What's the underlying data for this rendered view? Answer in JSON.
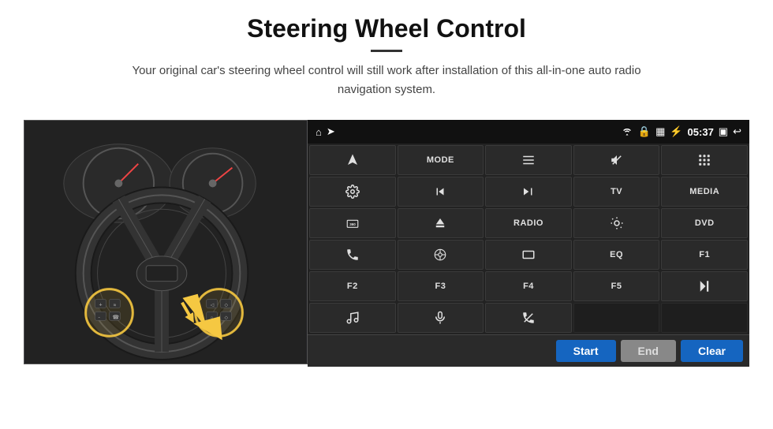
{
  "page": {
    "title": "Steering Wheel Control",
    "subtitle": "Your original car's steering wheel control will still work after installation of this all-in-one auto radio navigation system."
  },
  "status_bar": {
    "time": "05:37",
    "icons": [
      "home",
      "wifi",
      "lock",
      "sim",
      "bluetooth",
      "screen",
      "back"
    ]
  },
  "grid_buttons": [
    {
      "id": "nav",
      "type": "icon",
      "icon": "nav"
    },
    {
      "id": "mode",
      "type": "text",
      "label": "MODE"
    },
    {
      "id": "list",
      "type": "icon",
      "icon": "list"
    },
    {
      "id": "mute",
      "type": "icon",
      "icon": "mute"
    },
    {
      "id": "apps",
      "type": "icon",
      "icon": "apps"
    },
    {
      "id": "settings2",
      "type": "icon",
      "icon": "settings"
    },
    {
      "id": "prev",
      "type": "icon",
      "icon": "prev"
    },
    {
      "id": "next",
      "type": "icon",
      "icon": "next"
    },
    {
      "id": "tv",
      "type": "text",
      "label": "TV"
    },
    {
      "id": "media",
      "type": "text",
      "label": "MEDIA"
    },
    {
      "id": "360",
      "type": "text",
      "label": "360"
    },
    {
      "id": "eject",
      "type": "icon",
      "icon": "eject"
    },
    {
      "id": "radio",
      "type": "text",
      "label": "RADIO"
    },
    {
      "id": "brightness",
      "type": "icon",
      "icon": "brightness"
    },
    {
      "id": "dvd",
      "type": "text",
      "label": "DVD"
    },
    {
      "id": "phone",
      "type": "icon",
      "icon": "phone"
    },
    {
      "id": "navi",
      "type": "icon",
      "icon": "navi"
    },
    {
      "id": "screen",
      "type": "icon",
      "icon": "screen"
    },
    {
      "id": "eq",
      "type": "text",
      "label": "EQ"
    },
    {
      "id": "f1",
      "type": "text",
      "label": "F1"
    },
    {
      "id": "f2",
      "type": "text",
      "label": "F2"
    },
    {
      "id": "f3",
      "type": "text",
      "label": "F3"
    },
    {
      "id": "f4",
      "type": "text",
      "label": "F4"
    },
    {
      "id": "f5",
      "type": "text",
      "label": "F5"
    },
    {
      "id": "playpause",
      "type": "icon",
      "icon": "playpause"
    },
    {
      "id": "music",
      "type": "icon",
      "icon": "music"
    },
    {
      "id": "mic",
      "type": "icon",
      "icon": "mic"
    },
    {
      "id": "callend",
      "type": "icon",
      "icon": "callend"
    },
    {
      "id": "empty1",
      "type": "empty"
    },
    {
      "id": "empty2",
      "type": "empty"
    }
  ],
  "bottom_bar": {
    "start_label": "Start",
    "end_label": "End",
    "clear_label": "Clear"
  },
  "colors": {
    "blue_btn": "#1565c0",
    "gray_btn": "#888888",
    "grid_bg": "#2a2a2a",
    "panel_bg": "#1a1a1a"
  }
}
